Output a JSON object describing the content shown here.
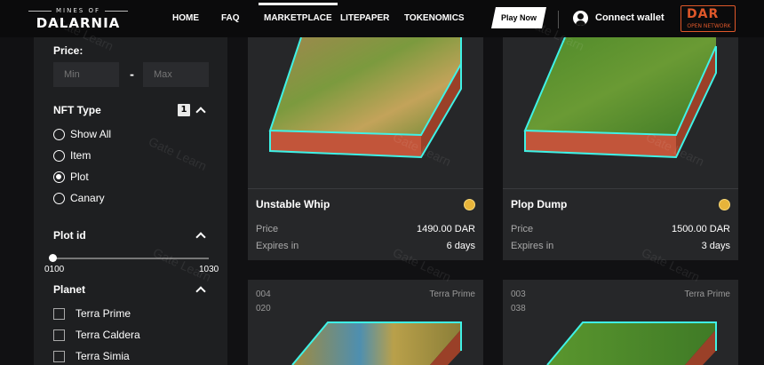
{
  "nav": {
    "logo_small": "MINES OF",
    "logo_big": "DALARNIA",
    "links": [
      "HOME",
      "FAQ",
      "MARKETPLACE",
      "LITEPAPER",
      "TOKENOMICS"
    ],
    "play_now": "Play Now",
    "connect_wallet": "Connect wallet",
    "dar_logo": "DAR",
    "dar_sub": "OPEN NETWORK"
  },
  "filters": {
    "price_label": "Price:",
    "min_placeholder": "Min",
    "max_placeholder": "Max",
    "dash": "-",
    "nft_type_label": "NFT Type",
    "nft_type_count": "1",
    "nft_types": [
      "Show All",
      "Item",
      "Plot",
      "Canary"
    ],
    "selected_type": "Plot",
    "plot_id_label": "Plot id",
    "plot_id_min": "0100",
    "plot_id_max": "1030",
    "planet_label": "Planet",
    "planets": [
      "Terra Prime",
      "Terra Caldera",
      "Terra Simia"
    ]
  },
  "cards": [
    {
      "name": "Unstable Whip",
      "price_label": "Price",
      "price": "1490.00 DAR",
      "expires_label": "Expires in",
      "expires": "6 days"
    },
    {
      "name": "Plop Dump",
      "price_label": "Price",
      "price": "1500.00 DAR",
      "expires_label": "Expires in",
      "expires": "3 days"
    },
    {
      "id_top": "004",
      "id_bottom": "020",
      "planet": "Terra Prime"
    },
    {
      "id_top": "003",
      "id_bottom": "038",
      "planet": "Terra Prime"
    }
  ],
  "watermark": "Gate Learn",
  "colors": {
    "accent_cyan": "#2fe0d8",
    "coin_gold": "#e7b43a",
    "dar_orange": "#e0582a"
  }
}
